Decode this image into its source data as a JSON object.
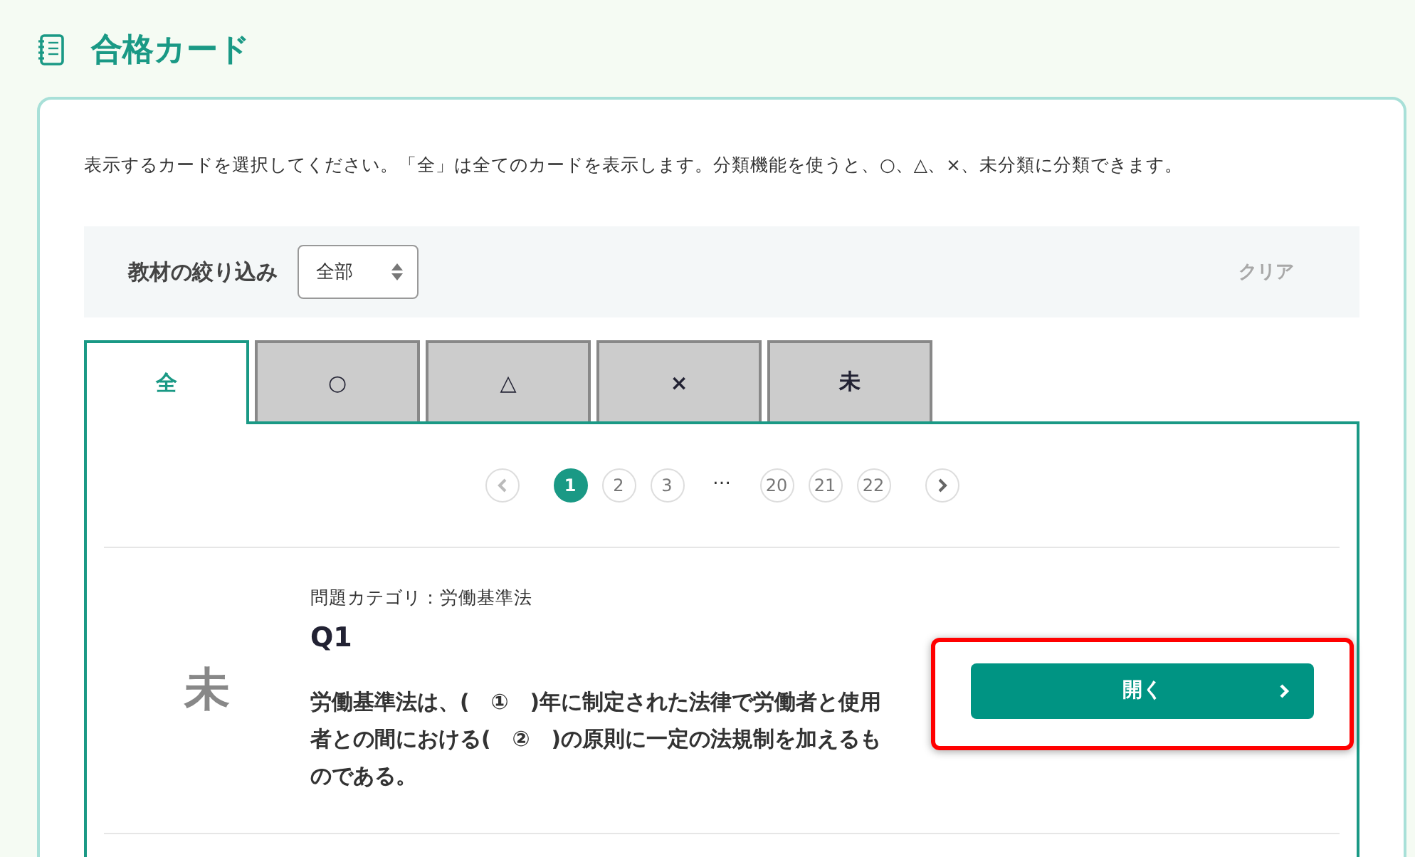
{
  "page": {
    "title": "合格カード"
  },
  "intro": "表示するカードを選択してください。「全」は全てのカードを表示します。分類機能を使うと、○、△、×、未分類に分類できます。",
  "filter": {
    "label": "教材の絞り込み",
    "select_value": "全部",
    "clear": "クリア",
    "clear_disabled": true
  },
  "tabs": [
    {
      "label": "全",
      "selected": true
    },
    {
      "label": "○",
      "selected": false
    },
    {
      "label": "△",
      "selected": false
    },
    {
      "label": "×",
      "selected": false
    },
    {
      "label": "未",
      "selected": false
    }
  ],
  "pagination": {
    "pages_before": [
      {
        "label": "1",
        "selected": true
      },
      {
        "label": "2",
        "selected": false
      },
      {
        "label": "3",
        "selected": false
      }
    ],
    "ellipsis": "…",
    "pages_after": [
      {
        "label": "20",
        "selected": false
      },
      {
        "label": "21",
        "selected": false
      },
      {
        "label": "22",
        "selected": false
      }
    ]
  },
  "cards": [
    {
      "status": "未",
      "category": "問題カテゴリ：労働基準法",
      "title": "Q1",
      "question": "労働基準法は、(　①　)年に制定された法律で労働者と使用者との間における(　②　)の原則に一定の法規制を加えるものである。",
      "button": "開く",
      "highlighted": true
    }
  ]
}
